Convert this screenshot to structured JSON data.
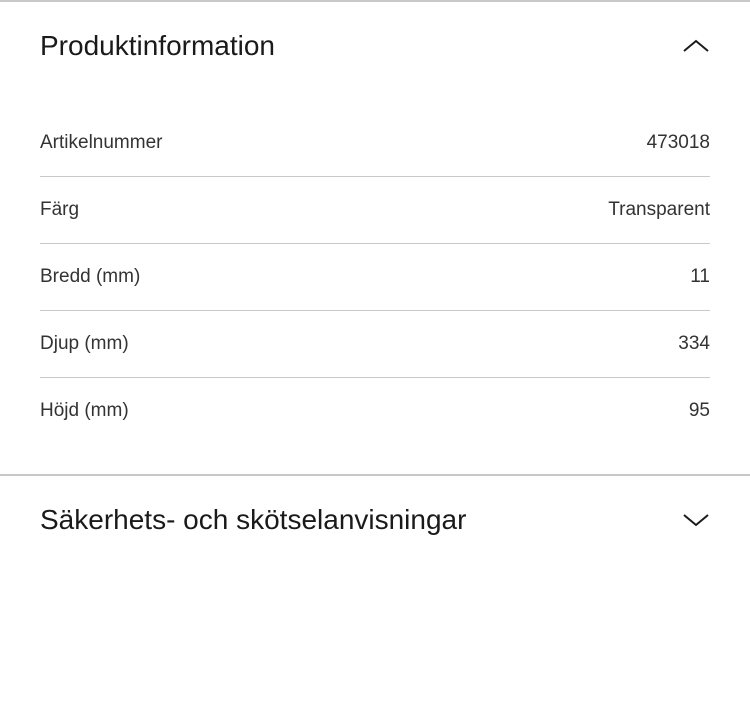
{
  "sections": {
    "productInfo": {
      "title": "Produktinformation",
      "rows": [
        {
          "label": "Artikelnummer",
          "value": "473018"
        },
        {
          "label": "Färg",
          "value": "Transparent"
        },
        {
          "label": "Bredd (mm)",
          "value": "11"
        },
        {
          "label": "Djup (mm)",
          "value": "334"
        },
        {
          "label": "Höjd (mm)",
          "value": "95"
        }
      ]
    },
    "safetyCare": {
      "title": "Säkerhets- och skötselanvisningar"
    }
  }
}
